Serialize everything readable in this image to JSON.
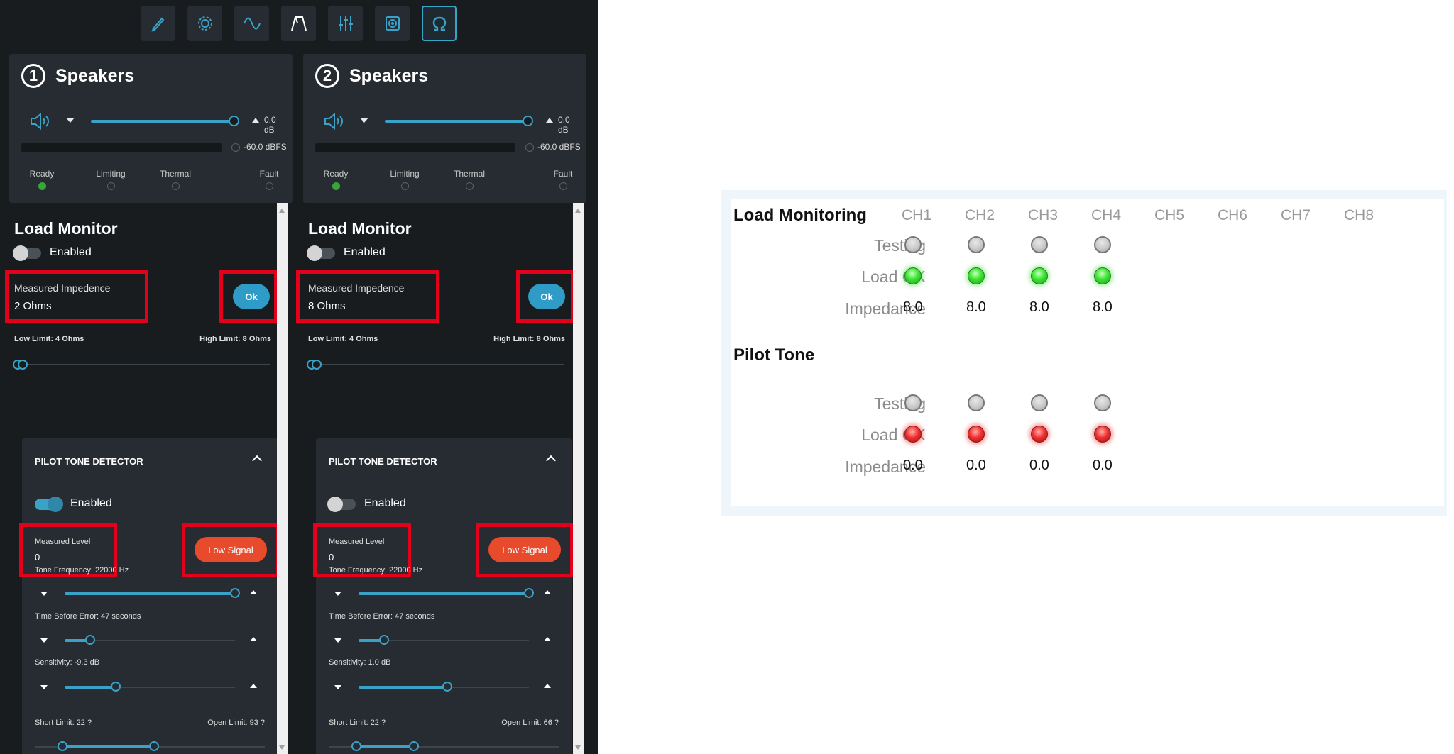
{
  "toolbar": {
    "icons": [
      "edit-icon",
      "settings-icon",
      "waveform-icon",
      "filter-icon",
      "mixer-icon",
      "speaker-icon",
      "impedance-icon"
    ],
    "active": "impedance-icon"
  },
  "channels": [
    {
      "number": "1",
      "name": "Speakers",
      "gain": "0.0 dB",
      "meter": "-60.0 dBFS",
      "status": {
        "ready": "Ready",
        "limiting": "Limiting",
        "thermal": "Thermal",
        "fault": "Fault"
      },
      "load_monitor": {
        "title": "Load Monitor",
        "enabled_label": "Enabled",
        "enabled": false,
        "measured_label": "Measured Impedence",
        "measured_value": "2 Ohms",
        "status_button": "Ok",
        "low_limit": "Low Limit: 4 Ohms",
        "high_limit": "High Limit: 8 Ohms"
      },
      "pilot": {
        "title": "PILOT TONE DETECTOR",
        "enabled_label": "Enabled",
        "enabled": true,
        "measured_label": "Measured Level",
        "measured_value": "0",
        "status_button": "Low Signal",
        "tone_frequency": "Tone Frequency: 22000 Hz",
        "time_before_error": "Time Before Error: 47 seconds",
        "sensitivity": "Sensitivity: -9.3 dB",
        "short_limit": "Short Limit: 22 ?",
        "open_limit": "Open Limit: 93 ?",
        "levels": {
          "tone": 1.0,
          "time": 0.15,
          "sens": 0.3,
          "short": 0.12,
          "open": 0.52
        }
      }
    },
    {
      "number": "2",
      "name": "Speakers",
      "gain": "0.0 dB",
      "meter": "-60.0 dBFS",
      "status": {
        "ready": "Ready",
        "limiting": "Limiting",
        "thermal": "Thermal",
        "fault": "Fault"
      },
      "load_monitor": {
        "title": "Load Monitor",
        "enabled_label": "Enabled",
        "enabled": false,
        "measured_label": "Measured Impedence",
        "measured_value": "8 Ohms",
        "status_button": "Ok",
        "low_limit": "Low Limit: 4 Ohms",
        "high_limit": "High Limit: 8 Ohms"
      },
      "pilot": {
        "title": "PILOT TONE DETECTOR",
        "enabled_label": "Enabled",
        "enabled": false,
        "measured_label": "Measured Level",
        "measured_value": "0",
        "status_button": "Low Signal",
        "tone_frequency": "Tone Frequency: 22000 Hz",
        "time_before_error": "Time Before Error: 47 seconds",
        "sensitivity": "Sensitivity: 1.0 dB",
        "short_limit": "Short Limit: 22 ?",
        "open_limit": "Open Limit: 66 ?",
        "levels": {
          "tone": 1.0,
          "time": 0.15,
          "sens": 0.52,
          "short": 0.12,
          "open": 0.37
        }
      }
    }
  ],
  "load_table": {
    "title": "Load Monitoring",
    "pilot_title": "Pilot Tone",
    "channels": [
      "CH1",
      "CH2",
      "CH3",
      "CH4",
      "CH5",
      "CH6",
      "CH7",
      "CH8"
    ],
    "rows": {
      "testing": "Testing",
      "load_ok": "Load OK",
      "impedance": "Impedance"
    },
    "load_monitoring": {
      "testing": [
        "grey",
        "grey",
        "grey",
        "grey"
      ],
      "load_ok": [
        "green",
        "green",
        "green",
        "green"
      ],
      "impedance": [
        "8.0",
        "8.0",
        "8.0",
        "8.0"
      ]
    },
    "pilot_tone": {
      "testing": [
        "grey",
        "grey",
        "grey",
        "grey"
      ],
      "load_ok": [
        "red",
        "red",
        "red",
        "red"
      ],
      "impedance": [
        "0.0",
        "0.0",
        "0.0",
        "0.0"
      ]
    }
  },
  "colors": {
    "accent": "#3aa1c7",
    "highlight": "#e2001a",
    "alert": "#e84b2c",
    "ok": "#2f9bc7"
  }
}
